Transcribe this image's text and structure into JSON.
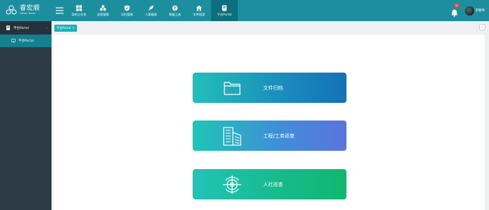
{
  "brand": {
    "name_cn": "睿宏顺",
    "name_en": "Safety Tower"
  },
  "colors": {
    "header": "#1d8e9e",
    "active_nav": "#0d6f7e",
    "sidebar": "#2c3b46",
    "sidebar_active": "#157f8d",
    "tab": "#1bb1b5"
  },
  "nav": [
    {
      "label": "我的工作台",
      "icon": "grid-icon"
    },
    {
      "label": "运营管理",
      "icon": "cluster-icon"
    },
    {
      "label": "项目管理",
      "icon": "shield-icon"
    },
    {
      "label": "人事管理",
      "icon": "feather-icon"
    },
    {
      "label": "数据工具",
      "icon": "tool-icon"
    },
    {
      "label": "文件档案",
      "icon": "home-icon"
    },
    {
      "label": "平台Portal",
      "icon": "book-icon"
    }
  ],
  "user": {
    "badge": "10",
    "name": "李朝伟"
  },
  "sidebar": {
    "group": "平台Portal",
    "items": [
      {
        "label": "平台Portal"
      }
    ]
  },
  "tabs": [
    {
      "label": "平台Portal",
      "close": "×"
    }
  ],
  "tabs_more": "···",
  "cards": [
    {
      "label": "文件归档",
      "icon": "folder-icon"
    },
    {
      "label": "工程/工务巡查",
      "icon": "buildings-icon"
    },
    {
      "label": "人社巡查",
      "icon": "target-icon"
    }
  ]
}
